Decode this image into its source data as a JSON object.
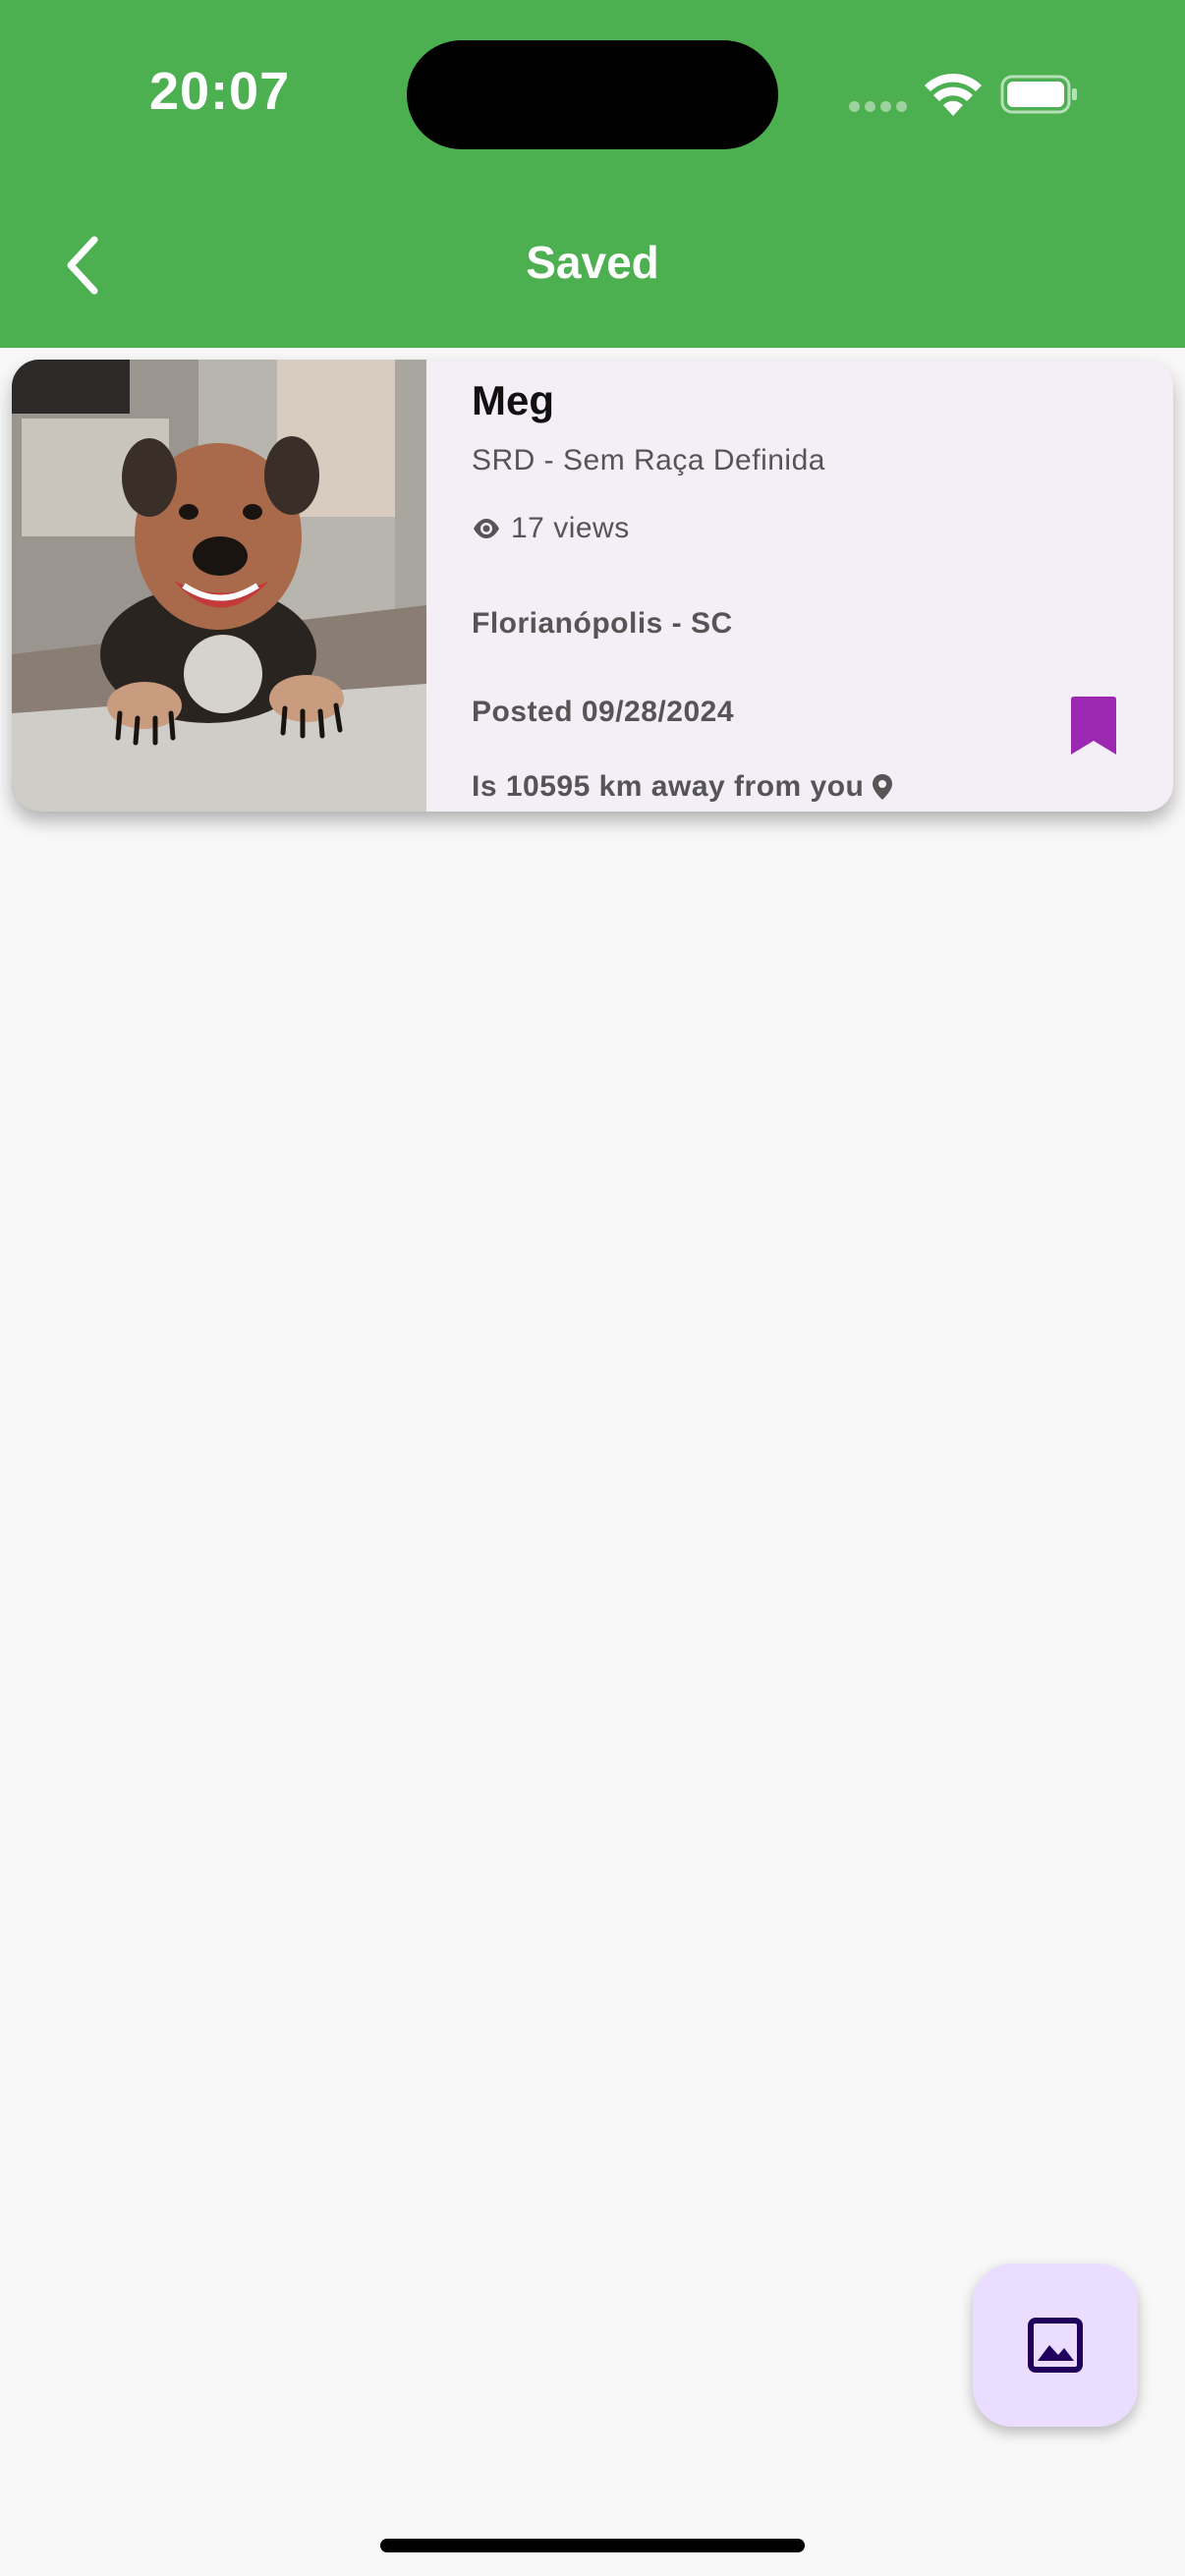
{
  "status_bar": {
    "time": "20:07"
  },
  "header": {
    "title": "Saved",
    "back_icon": "chevron-left-icon",
    "background_color": "#4caf50"
  },
  "saved_items": [
    {
      "name": "Meg",
      "breed": "SRD - Sem Raça Definida",
      "views": "17 views",
      "location": "Florianópolis - SC",
      "posted": "Posted 09/28/2024",
      "distance": "Is 10595 km away from you",
      "bookmark_icon": "bookmark-icon",
      "bookmark_color": "#9c27b0"
    }
  ],
  "fab": {
    "icon": "image-icon",
    "background_color": "#eaddff"
  }
}
